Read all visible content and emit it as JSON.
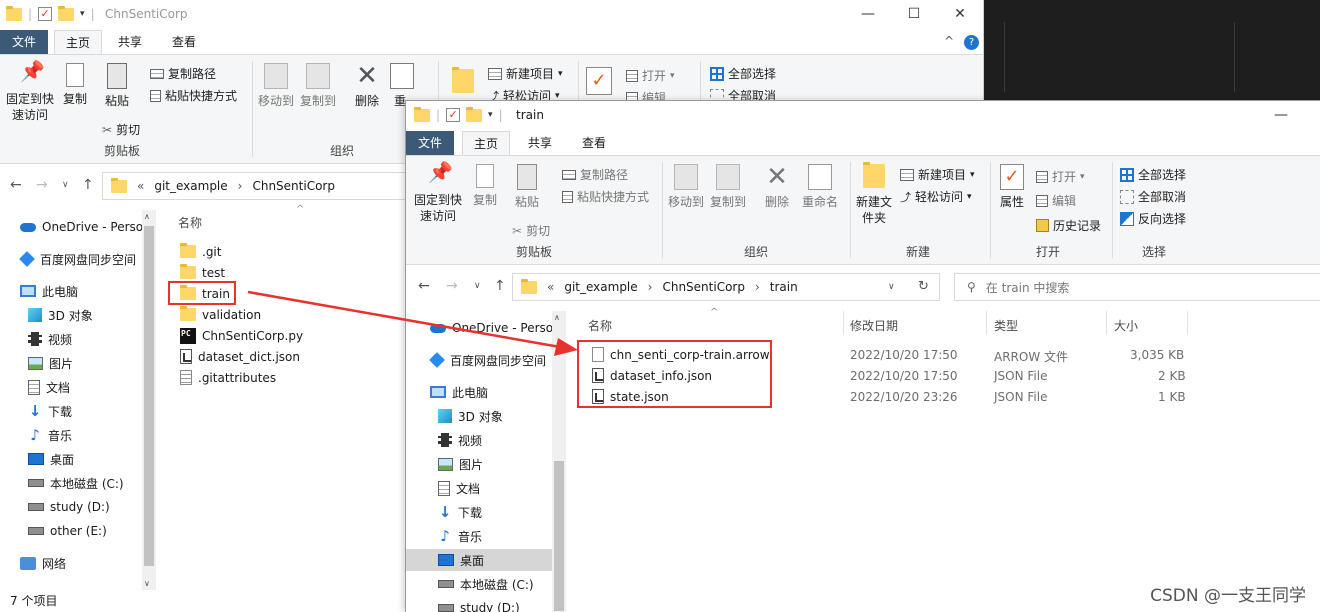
{
  "colors": {
    "file_tab": "#3c5a78",
    "annotation": "#e8322e",
    "folder": "#ffd769"
  },
  "back_window": {
    "title": "ChnSentiCorp",
    "tabs": [
      "文件",
      "主页",
      "共享",
      "查看"
    ],
    "ribbon": {
      "pin": "固定到快速访问",
      "copy": "复制",
      "paste": "粘贴",
      "copy_path": "复制路径",
      "paste_shortcut": "粘贴快捷方式",
      "cut": "剪切",
      "clipboard": "剪贴板",
      "move_to": "移动到",
      "copy_to": "复制到",
      "delete": "删除",
      "rename_partial": "重",
      "organize": "组织",
      "new_item": "新建项目",
      "easy_access": "轻松访问",
      "open": "打开",
      "edit_partial": "编辑",
      "select_all": "全部选择",
      "select_none": "全部取消"
    },
    "breadcrumb": [
      "git_example",
      "ChnSentiCorp"
    ],
    "nav": [
      "OneDrive - Perso",
      "百度网盘同步空间",
      "此电脑",
      "3D 对象",
      "视频",
      "图片",
      "文档",
      "下载",
      "音乐",
      "桌面",
      "本地磁盘 (C:)",
      "study (D:)",
      "other (E:)",
      "网络"
    ],
    "column_name": "名称",
    "files": [
      ".git",
      "test",
      "train",
      "validation",
      "ChnSentiCorp.py",
      "dataset_dict.json",
      ".gitattributes"
    ],
    "status": "7 个项目"
  },
  "front_window": {
    "title": "train",
    "tabs": [
      "文件",
      "主页",
      "共享",
      "查看"
    ],
    "ribbon": {
      "pin": "固定到快速访问",
      "copy": "复制",
      "paste": "粘贴",
      "copy_path": "复制路径",
      "paste_shortcut": "粘贴快捷方式",
      "cut": "剪切",
      "clipboard": "剪贴板",
      "move_to": "移动到",
      "copy_to": "复制到",
      "delete": "删除",
      "rename": "重命名",
      "organize": "组织",
      "new_folder": "新建文件夹",
      "new_item": "新建项目",
      "easy_access": "轻松访问",
      "new": "新建",
      "properties": "属性",
      "open": "打开",
      "edit": "编辑",
      "history": "历史记录",
      "open_group": "打开",
      "select_all": "全部选择",
      "select_none": "全部取消",
      "invert": "反向选择",
      "select": "选择"
    },
    "breadcrumb": [
      "git_example",
      "ChnSentiCorp",
      "train"
    ],
    "search_placeholder": "在 train 中搜索",
    "nav": [
      "OneDrive - Perso",
      "百度网盘同步空间",
      "此电脑",
      "3D 对象",
      "视频",
      "图片",
      "文档",
      "下载",
      "音乐",
      "桌面",
      "本地磁盘 (C:)",
      "study (D:)"
    ],
    "columns": {
      "name": "名称",
      "date": "修改日期",
      "type": "类型",
      "size": "大小"
    },
    "files": [
      {
        "name": "chn_senti_corp-train.arrow",
        "date": "2022/10/20 17:50",
        "type": "ARROW 文件",
        "size": "3,035 KB"
      },
      {
        "name": "dataset_info.json",
        "date": "2022/10/20 17:50",
        "type": "JSON File",
        "size": "2 KB"
      },
      {
        "name": "state.json",
        "date": "2022/10/20 23:26",
        "type": "JSON File",
        "size": "1 KB"
      }
    ]
  },
  "watermark": "CSDN @一支王同学"
}
